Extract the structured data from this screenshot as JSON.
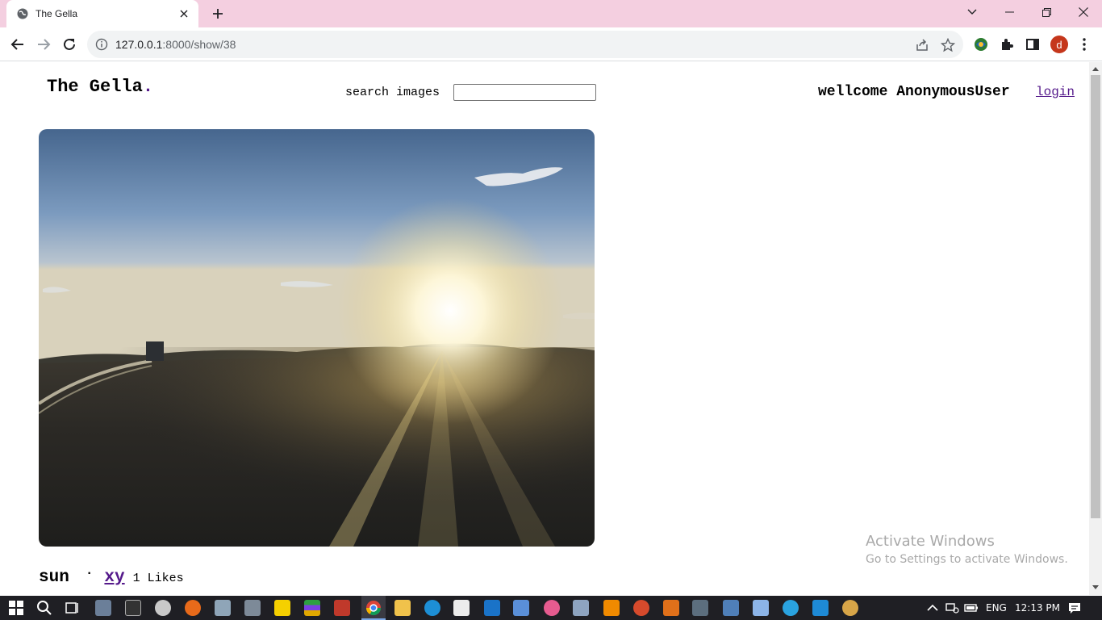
{
  "browser": {
    "tab_title": "The Gella",
    "url_host": "127.0.0.1",
    "url_rest": ":8000/show/38",
    "profile_initial": "d",
    "colors": {
      "tabstrip": "#f4cfe0",
      "avatar": "#c5361b"
    }
  },
  "header": {
    "site_title": "The Gella",
    "site_title_link": ".",
    "search_label": "search images",
    "search_value": "",
    "welcome_text": "wellcome AnonymousUser",
    "login_label": "login"
  },
  "post": {
    "image_alt_icon": "sunset-photo",
    "title": "sun",
    "separator": "·",
    "author": "xy",
    "likes": "1 Likes"
  },
  "watermark": {
    "line1": "Activate Windows",
    "line2": "Go to Settings to activate Windows."
  },
  "taskbar": {
    "lang": "ENG",
    "time": "12:13 PM"
  }
}
